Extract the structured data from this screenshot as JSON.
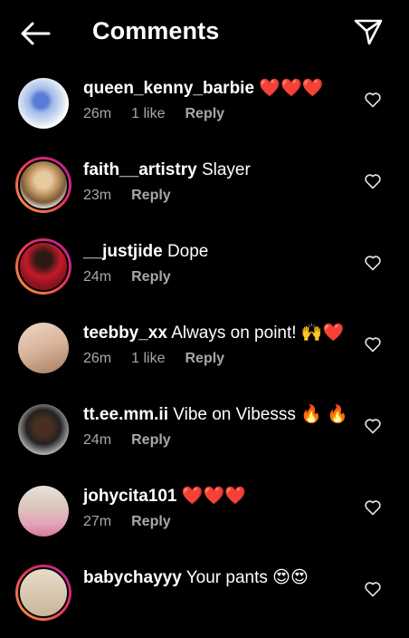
{
  "header": {
    "title": "Comments"
  },
  "comments": [
    {
      "username": "queen_kenny_barbie",
      "text": "❤️❤️❤️",
      "time": "26m",
      "likes": "1 like",
      "reply": "Reply"
    },
    {
      "username": "faith__artistry",
      "text": "Slayer",
      "time": "23m",
      "likes": "",
      "reply": "Reply"
    },
    {
      "username": "__justjide",
      "text": "Dope",
      "time": "24m",
      "likes": "",
      "reply": "Reply"
    },
    {
      "username": "teebby_xx",
      "text": "Always on point! 🙌❤️",
      "time": "26m",
      "likes": "1 like",
      "reply": "Reply"
    },
    {
      "username": "tt.ee.mm.ii",
      "text": "Vibe on Vibesss 🔥 🔥",
      "time": "24m",
      "likes": "",
      "reply": "Reply"
    },
    {
      "username": "johycita101",
      "text": "❤️❤️❤️",
      "time": "27m",
      "likes": "",
      "reply": "Reply"
    },
    {
      "username": "babychayyy",
      "text": "Your pants 😍😍",
      "time": "",
      "likes": "",
      "reply": ""
    }
  ]
}
